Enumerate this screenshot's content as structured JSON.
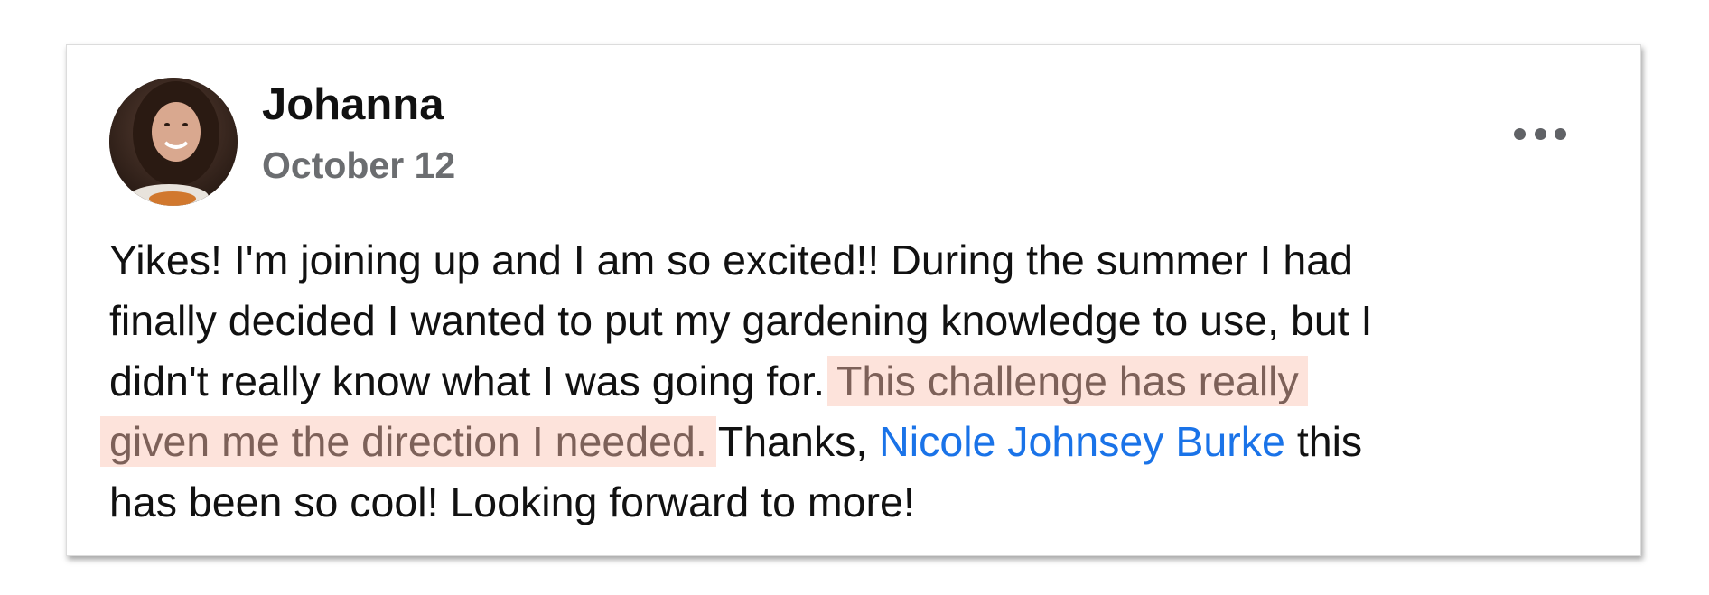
{
  "post": {
    "author": "Johanna",
    "date": "October 12",
    "more_icon": "ellipsis-horizontal-icon",
    "avatar_icon": "user-photo",
    "text": {
      "line1": "Yikes! I'm joining up and I am so excited!! During the summer I had",
      "line2": "finally decided I wanted to put my gardening knowledge to use, but I",
      "line3_plain": "didn't really know what I was going for. ",
      "line3_highlight": "This challenge has really",
      "line4_highlight": "given me the direction I needed.",
      "line4_thanks": " Thanks, ",
      "mention": "Nicole Johnsey Burke",
      "line4_end": " this",
      "line5": "has been so cool! Looking forward to more!"
    }
  },
  "colors": {
    "highlight_bg": "#fde3db",
    "highlight_text": "#7d6159",
    "mention": "#1a73e8",
    "date": "#6b6d70"
  }
}
